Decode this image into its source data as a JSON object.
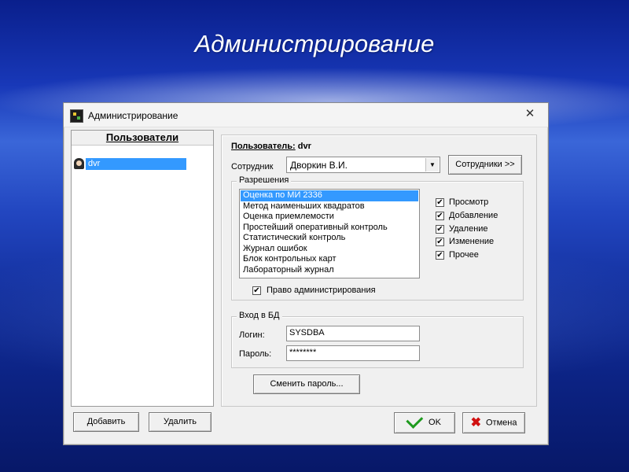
{
  "slide": {
    "title": "Администрирование"
  },
  "window": {
    "title": "Администрирование",
    "close_glyph": "✕"
  },
  "users_panel": {
    "header": "Пользователи",
    "users": [
      {
        "login": "dvr"
      }
    ],
    "add_button": "Добавить",
    "delete_button": "Удалить"
  },
  "user_details": {
    "user_label": "Пользователь:",
    "user_value": "dvr",
    "employee_label": "Сотрудник",
    "employee_value": "Дворкин В.И.",
    "employees_button": "Сотрудники >>"
  },
  "permissions": {
    "legend": "Разрешения",
    "items": [
      "Оценка по МИ 2336",
      "Метод наименьших квадратов",
      "Оценка приемлемости",
      "Простейший оперативный контроль",
      "Статистический контроль",
      "Журнал ошибок",
      "Блок контрольных карт",
      "Лабораторный журнал"
    ],
    "selected_index": 0,
    "checks": [
      {
        "label": "Просмотр",
        "checked": true
      },
      {
        "label": "Добавление",
        "checked": true
      },
      {
        "label": "Удаление",
        "checked": true
      },
      {
        "label": "Изменение",
        "checked": true
      },
      {
        "label": "Прочее",
        "checked": true
      }
    ],
    "admin_right_label": "Право администрирования",
    "admin_right_checked": true,
    "check_glyph": "✔"
  },
  "db_login": {
    "legend": "Вход в БД",
    "login_label": "Логин:",
    "login_value": "SYSDBA",
    "password_label": "Пароль:",
    "password_value": "********"
  },
  "change_password_button": "Сменить пароль...",
  "ok_button": "OK",
  "cancel_button": "Отмена"
}
